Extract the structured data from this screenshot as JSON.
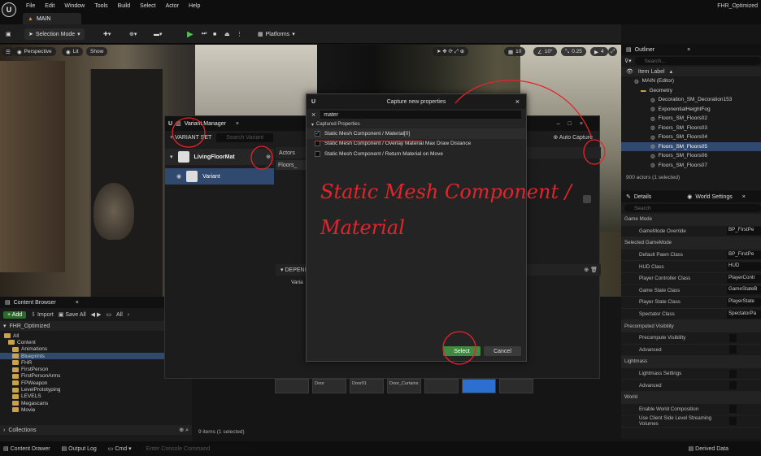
{
  "menu": {
    "items": [
      "File",
      "Edit",
      "Window",
      "Tools",
      "Build",
      "Select",
      "Actor",
      "Help"
    ],
    "project": "FHR_Optimized"
  },
  "tab": {
    "label": "MAIN"
  },
  "toolbar": {
    "selection_mode": "Selection Mode",
    "platforms": "Platforms"
  },
  "viewport": {
    "perspective": "Perspective",
    "lit": "Lit",
    "show": "Show",
    "grid_snap": "10",
    "rot_snap": "10°",
    "scale_snap": "0.25",
    "cam_speed": "4"
  },
  "outliner": {
    "title": "Outliner",
    "search_placeholder": "Search...",
    "column": "Item Label",
    "items": [
      "MAIN (Editor)",
      "Geometry",
      "Decoration_SM_Decoration153",
      "ExponentialHeightFog",
      "Floors_SM_Floors02",
      "Floors_SM_Floors03",
      "Floors_SM_Floors04",
      "Floors_SM_Floors05",
      "Floors_SM_Floors06",
      "Floors_SM_Floors07"
    ],
    "selected_index": 7,
    "count": "900 actors (1 selected)"
  },
  "details": {
    "title": "Details",
    "world_settings": "World Settings",
    "search_placeholder": "Search",
    "rows": [
      {
        "label": "Game Mode",
        "value": "",
        "head": true
      },
      {
        "label": "GameMode Override",
        "value": "BP_FirstPe"
      },
      {
        "label": "Selected GameMode",
        "value": "",
        "head": true
      },
      {
        "label": "Default Pawn Class",
        "value": "BP_FirstPe"
      },
      {
        "label": "HUD Class",
        "value": "HUD"
      },
      {
        "label": "Player Controller Class",
        "value": "PlayerContr"
      },
      {
        "label": "Game State Class",
        "value": "GameStateB"
      },
      {
        "label": "Player State Class",
        "value": "PlayerState"
      },
      {
        "label": "Spectator Class",
        "value": "SpectatorPa"
      },
      {
        "label": "Precomputed Visibility",
        "value": "",
        "head": true
      },
      {
        "label": "Precompute Visibility",
        "value": ""
      },
      {
        "label": "Advanced",
        "value": ""
      },
      {
        "label": "Lightmass",
        "value": "",
        "head": true
      },
      {
        "label": "Lightmass Settings",
        "value": ""
      },
      {
        "label": "Advanced",
        "value": ""
      },
      {
        "label": "World",
        "value": "",
        "head": true
      },
      {
        "label": "Enable World Composition",
        "value": ""
      },
      {
        "label": "Use Client Side Level Streaming Volumes",
        "value": ""
      }
    ]
  },
  "content_browser": {
    "title": "Content Browser",
    "add": "Add",
    "import": "Import",
    "save_all": "Save All",
    "all": "All",
    "root": "FHR_Optimized",
    "tree": [
      "All",
      "Content",
      "Animations",
      "Blueprints",
      "FHR",
      "FirstPerson",
      "FirstPersonArms",
      "FPWeapon",
      "LevelPrototyping",
      "LEVELS",
      "Megascans",
      "Movie"
    ],
    "collections": "Collections",
    "items_count": "9 items (1 selected)"
  },
  "status": {
    "content_drawer": "Content Drawer",
    "output_log": "Output Log",
    "cmd": "Cmd",
    "console_placeholder": "Enter Console Command",
    "derived_data": "Derived Data"
  },
  "variant_manager": {
    "title": "Variant Manager",
    "add_set": "+ VARIANT SET",
    "search_placeholder": "Search Variant",
    "set_name": "LivingFloorMat",
    "variant": "Variant",
    "actors": "Actors",
    "actor_item": "Floors_",
    "auto_capture": "Auto Capture",
    "depend": "DEPEND",
    "varia": "Varia",
    "tiles": [
      "Door",
      "Door01",
      "Door_Curtains",
      "",
      ""
    ]
  },
  "capture": {
    "title": "Capture new properties",
    "search": "mater",
    "section": "Captured Properties",
    "options": [
      {
        "label": "Static Mesh Component / Material[0]",
        "checked": true
      },
      {
        "label": "Static Mesh Component / Overlay Material Max Draw Distance",
        "checked": false
      },
      {
        "label": "Static Mesh Component / Return Material on Move",
        "checked": false
      }
    ],
    "select": "Select",
    "cancel": "Cancel"
  },
  "annotation": {
    "line1": "Static Mesh Component /",
    "line2": "Material"
  },
  "colors": {
    "accent": "#3f8a3f",
    "selection": "#2f4a6e",
    "annotation": "#e3242b"
  }
}
